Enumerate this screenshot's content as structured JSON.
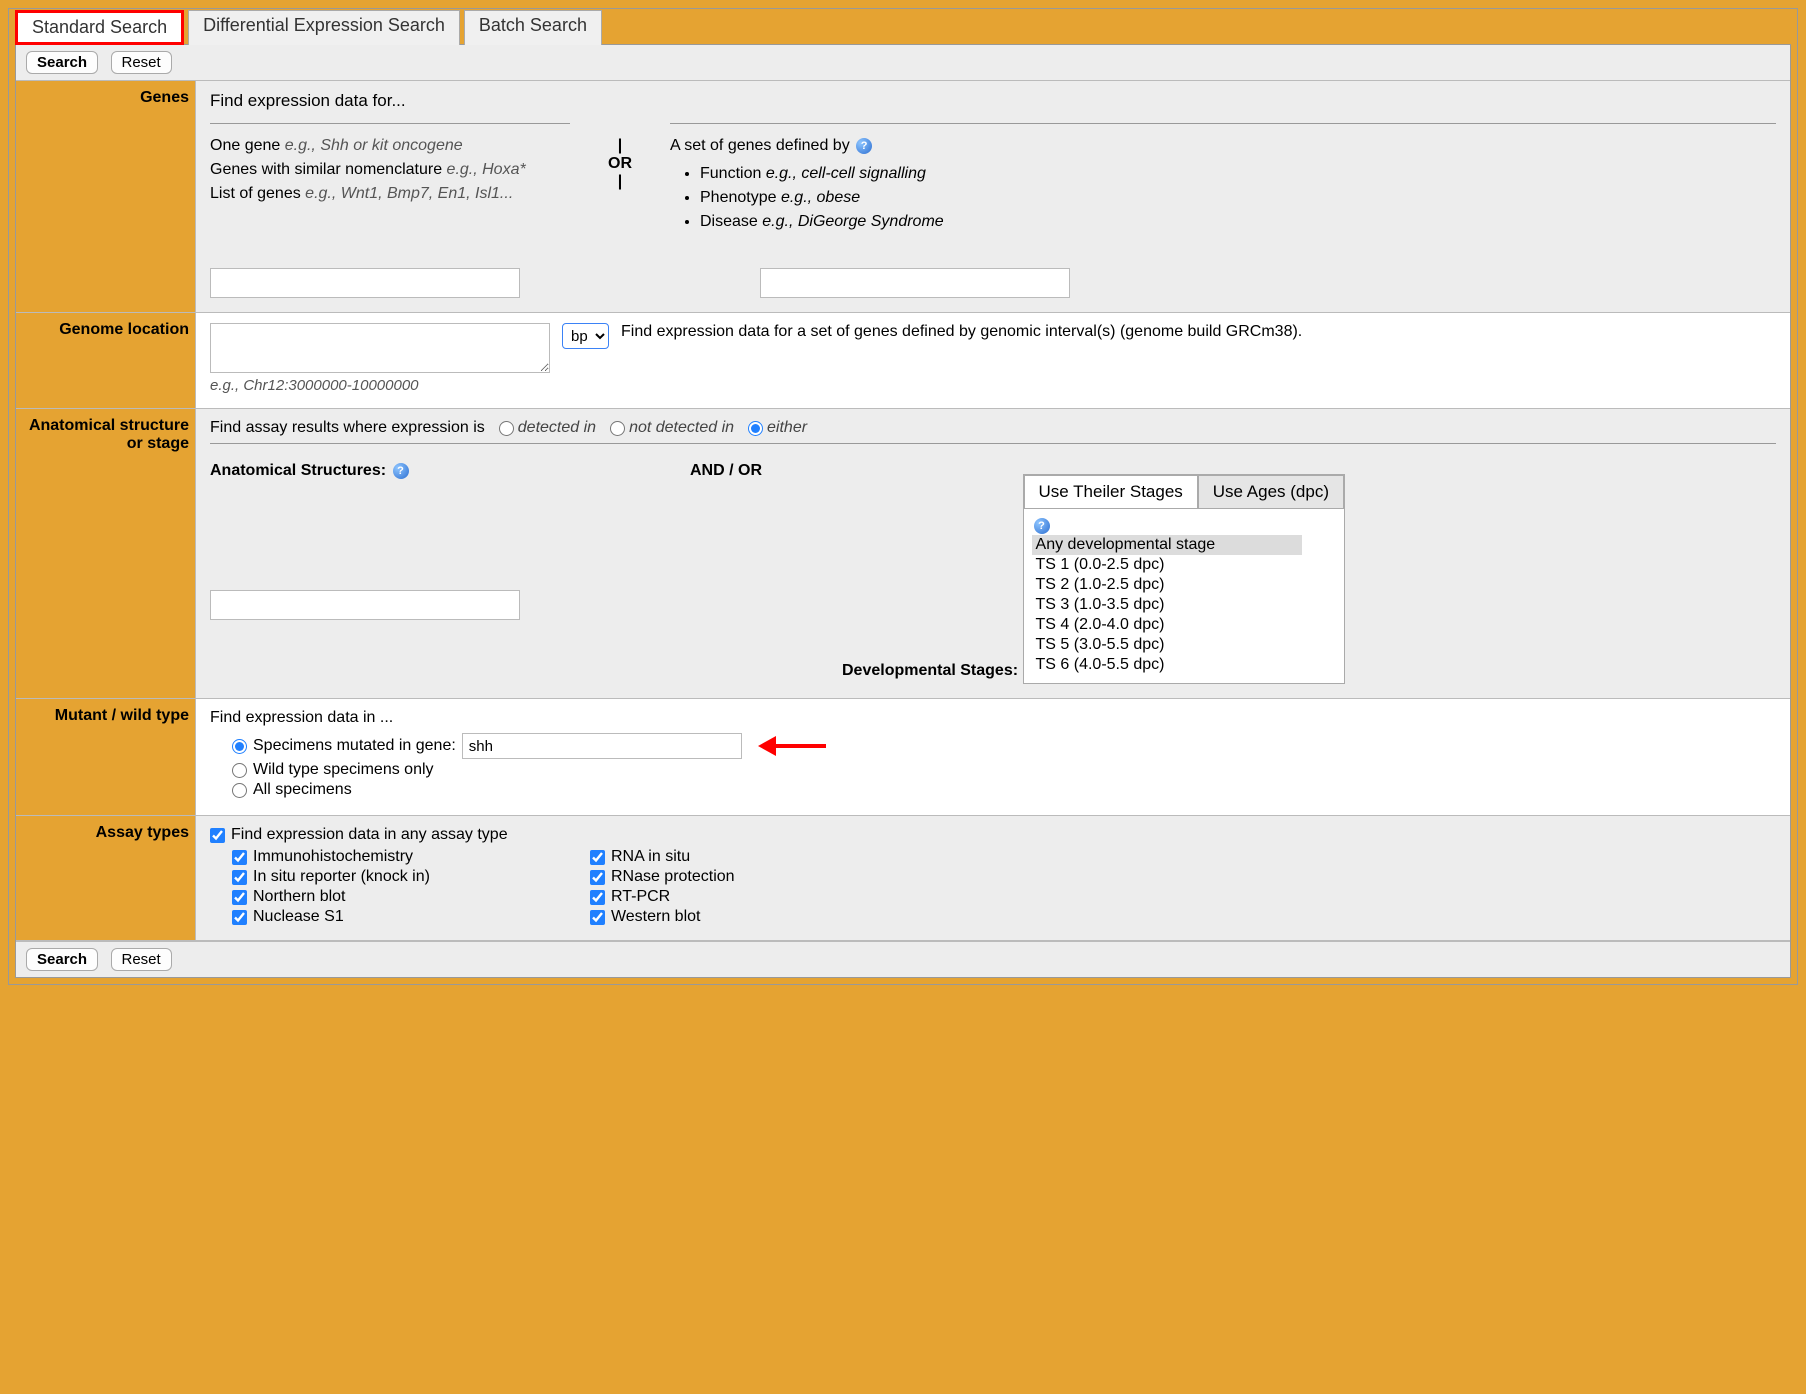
{
  "tabs": {
    "standard": "Standard Search",
    "differential": "Differential Expression Search",
    "batch": "Batch Search"
  },
  "buttons": {
    "search": "Search",
    "reset": "Reset"
  },
  "genes": {
    "label": "Genes",
    "heading": "Find expression data for...",
    "one_gene": "One gene ",
    "one_gene_eg": "e.g., Shh or kit oncogene",
    "similar": "Genes with similar nomenclature ",
    "similar_eg": "e.g., Hoxa*",
    "list": "List of genes ",
    "list_eg": "e.g., Wnt1, Bmp7, En1, Isl1...",
    "or": "OR",
    "set_heading": "A set of genes defined by ",
    "bullets": {
      "func": "Function ",
      "func_eg": "e.g., cell-cell signalling",
      "pheno": "Phenotype ",
      "pheno_eg": "e.g., obese",
      "disease": "Disease ",
      "disease_eg": "e.g., DiGeorge Syndrome"
    }
  },
  "genome": {
    "label": "Genome location",
    "unit": "bp",
    "desc": "Find expression data for a set of genes defined by genomic interval(s) (genome build GRCm38).",
    "hint": "e.g., Chr12:3000000-10000000"
  },
  "anat": {
    "label": "Anatomical structure or stage",
    "heading": "Find assay results where expression is",
    "detected": "detected in",
    "not_detected": "not detected in",
    "either": "either",
    "structures": "Anatomical Structures:",
    "andor": "AND / OR",
    "stages": "Developmental Stages:",
    "tab_theiler": "Use Theiler Stages",
    "tab_ages": "Use Ages (dpc)",
    "stage_opts": [
      "Any developmental stage",
      "TS 1 (0.0-2.5 dpc)",
      "TS 2 (1.0-2.5 dpc)",
      "TS 3 (1.0-3.5 dpc)",
      "TS 4 (2.0-4.0 dpc)",
      "TS 5 (3.0-5.5 dpc)",
      "TS 6 (4.0-5.5 dpc)"
    ]
  },
  "mutant": {
    "label": "Mutant / wild type",
    "heading": "Find expression data in ...",
    "specimens_mutated": "Specimens mutated in gene:",
    "gene_value": "shh",
    "wild": "Wild type specimens only",
    "all": "All specimens"
  },
  "assay": {
    "label": "Assay types",
    "any": "Find expression data in any assay type",
    "left": [
      "Immunohistochemistry",
      "In situ reporter (knock in)",
      "Northern blot",
      "Nuclease S1"
    ],
    "right": [
      "RNA in situ",
      "RNase protection",
      "RT-PCR",
      "Western blot"
    ]
  },
  "help_icon": "?"
}
